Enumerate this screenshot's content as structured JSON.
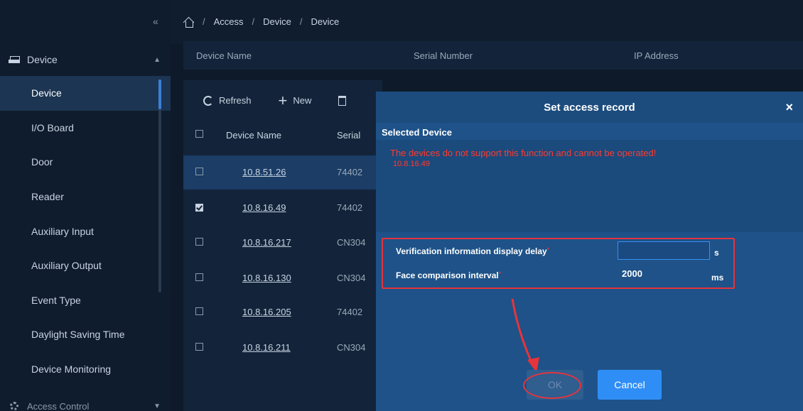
{
  "sidebar": {
    "collapse_icon": "double-chevron-left",
    "group": {
      "label": "Device",
      "icon": "device-icon"
    },
    "items": [
      {
        "label": "Device",
        "active": true
      },
      {
        "label": "I/O Board"
      },
      {
        "label": "Door"
      },
      {
        "label": "Reader"
      },
      {
        "label": "Auxiliary Input"
      },
      {
        "label": "Auxiliary Output"
      },
      {
        "label": "Event Type"
      },
      {
        "label": "Daylight Saving Time"
      },
      {
        "label": "Device Monitoring"
      }
    ],
    "group2": {
      "label": "Access Control"
    }
  },
  "breadcrumb": {
    "items": [
      "Access",
      "Device",
      "Device"
    ],
    "separator": "/"
  },
  "top_header": {
    "columns": [
      "Device Name",
      "Serial Number",
      "IP Address"
    ]
  },
  "toolbar": {
    "refresh": "Refresh",
    "new": "New"
  },
  "table": {
    "columns": [
      "Device Name",
      "Serial"
    ],
    "rows": [
      {
        "name": "10.8.51.26",
        "serial": "74402",
        "checked": false,
        "highlighted": true
      },
      {
        "name": "10.8.16.49",
        "serial": "74402",
        "checked": true,
        "highlighted": false
      },
      {
        "name": "10.8.16.217",
        "serial": "CN304",
        "checked": false,
        "highlighted": false
      },
      {
        "name": "10.8.16.130",
        "serial": "CN304",
        "checked": false,
        "highlighted": false
      },
      {
        "name": "10.8.16.205",
        "serial": "74402",
        "checked": false,
        "highlighted": false
      },
      {
        "name": "10.8.16.211",
        "serial": "CN304",
        "checked": false,
        "highlighted": false
      }
    ]
  },
  "modal": {
    "title": "Set access record",
    "close": "×",
    "selected_label": "Selected Device",
    "error_message": "The devices do not support this function and cannot be operated!",
    "error_device": "10.8.16.49",
    "fields": {
      "delay_label": "Verification information display delay",
      "delay_value": "",
      "delay_unit": "s",
      "interval_label": "Face comparison interval",
      "interval_value": "2000",
      "interval_unit": "ms",
      "required_mark": "*"
    },
    "ok": "OK",
    "cancel": "Cancel"
  },
  "colors": {
    "accent": "#2f8ef6",
    "error": "#ff3b30",
    "annotation": "#e6343c"
  }
}
